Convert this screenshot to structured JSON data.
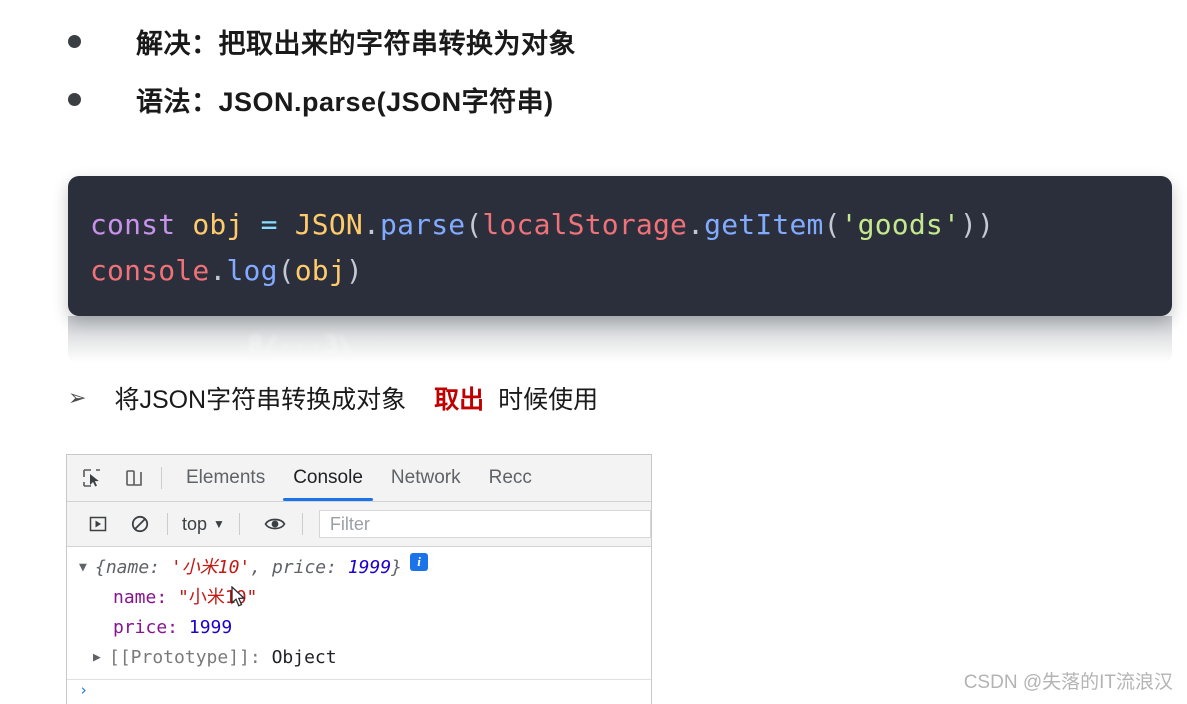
{
  "slide": {
    "bullets": [
      {
        "marker": "dot",
        "text": "解决：把取出来的字符串转换为对象"
      },
      {
        "marker": "dot",
        "text": "语法：JSON.parse(JSON字符串)"
      }
    ],
    "code_block": {
      "background": "#2a2f3b",
      "lines": [
        {
          "tokens": [
            {
              "text": "const",
              "cls": "t-kw"
            },
            {
              "text": " ",
              "cls": "t-punct"
            },
            {
              "text": "obj",
              "cls": "t-var"
            },
            {
              "text": " ",
              "cls": "t-punct"
            },
            {
              "text": "=",
              "cls": "t-op"
            },
            {
              "text": " ",
              "cls": "t-punct"
            },
            {
              "text": "JSON",
              "cls": "t-obj"
            },
            {
              "text": ".",
              "cls": "t-punct"
            },
            {
              "text": "parse",
              "cls": "t-fn"
            },
            {
              "text": "(",
              "cls": "t-punct"
            },
            {
              "text": "localStorage",
              "cls": "t-ident"
            },
            {
              "text": ".",
              "cls": "t-punct"
            },
            {
              "text": "getItem",
              "cls": "t-fn"
            },
            {
              "text": "(",
              "cls": "t-punct"
            },
            {
              "text": "'goods'",
              "cls": "t-str"
            },
            {
              "text": "))",
              "cls": "t-punct"
            }
          ]
        },
        {
          "tokens": [
            {
              "text": "console",
              "cls": "t-ident"
            },
            {
              "text": ".",
              "cls": "t-punct"
            },
            {
              "text": "log",
              "cls": "t-fn"
            },
            {
              "text": "(",
              "cls": "t-punct"
            },
            {
              "text": "obj",
              "cls": "t-var"
            },
            {
              "text": ")",
              "cls": "t-punct"
            }
          ]
        }
      ],
      "ghost_reflection_text": "8/---3\\"
    },
    "note": {
      "arrow": "➢",
      "lead": "将JSON字符串转换成对象",
      "emphasis": "取出",
      "tail": "时候使用",
      "emphasis_color": "#c00000"
    }
  },
  "devtools": {
    "icons": {
      "inspect": "inspect-element-icon",
      "device": "device-toolbar-icon",
      "execute": "execute-snippet-icon",
      "clear": "clear-console-icon",
      "eye": "live-expression-icon"
    },
    "tabs": [
      {
        "label": "Elements",
        "active": false
      },
      {
        "label": "Console",
        "active": true
      },
      {
        "label": "Network",
        "active": false
      },
      {
        "label": "Recc",
        "active": false
      }
    ],
    "active_tab_color": "#1a73e8",
    "filter_bar": {
      "context": "top",
      "caret": "▼",
      "filter_placeholder": "Filter"
    },
    "console_output": {
      "summary": {
        "triangle": "▼",
        "open_brace": "{",
        "key1": "name",
        "colon1": ": ",
        "value1": "'小米10'",
        "comma": ", ",
        "key2": "price",
        "colon2": ": ",
        "value2": "1999",
        "close_brace": "}",
        "info_badge": "i"
      },
      "properties": [
        {
          "key": "name:",
          "value": "\"小米10\"",
          "value_type": "string"
        },
        {
          "key": "price:",
          "value": "1999",
          "value_type": "number"
        }
      ],
      "prototype": {
        "triangle": "▶",
        "label": "[[Prototype]]:",
        "value": "Object"
      }
    },
    "prompt": "›"
  },
  "watermark": "CSDN @失落的IT流浪汉"
}
